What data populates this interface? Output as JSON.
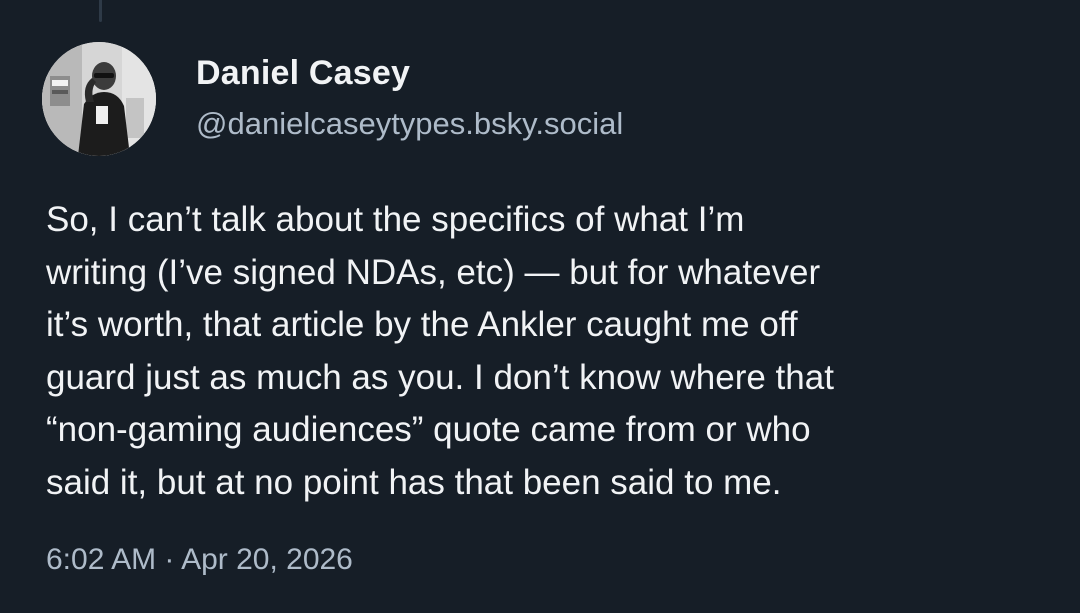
{
  "post": {
    "author": {
      "display_name": "Daniel Casey",
      "handle": "@danielcaseytypes.bsky.social"
    },
    "text_lines": [
      "So, I can’t talk about the specifics of what I’m",
      "writing (I’ve signed NDAs, etc) — but for whatever",
      "it’s worth, that article by the Ankler caught me off",
      "guard just as much as you. I don’t know where that",
      "“non-gaming audiences” quote came from or who",
      "said it, but at no point has that been said to me."
    ],
    "timestamp": "6:02 AM · Apr 20, 2026"
  },
  "colors": {
    "background": "#161e27",
    "text_primary": "#f1f3f5",
    "text_secondary": "#aebbc9",
    "thread_line": "#2e3a47"
  }
}
